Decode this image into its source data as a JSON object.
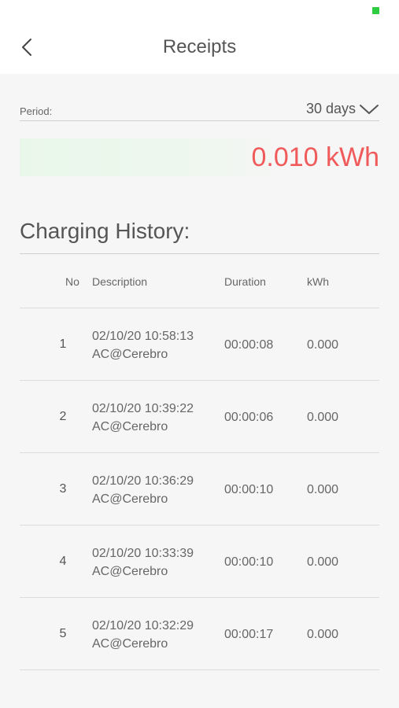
{
  "header": {
    "title": "Receipts"
  },
  "filter": {
    "period_label": "Period:",
    "period_value": "30 days"
  },
  "summary": {
    "total_kwh": "0.010 kWh"
  },
  "history": {
    "title": "Charging History:",
    "columns": {
      "no": "No",
      "description": "Description",
      "duration": "Duration",
      "kwh": "kWh"
    },
    "rows": [
      {
        "no": "1",
        "datetime": "02/10/20 10:58:13",
        "station": "AC@Cerebro",
        "duration": "00:00:08",
        "kwh": "0.000"
      },
      {
        "no": "2",
        "datetime": "02/10/20 10:39:22",
        "station": "AC@Cerebro",
        "duration": "00:00:06",
        "kwh": "0.000"
      },
      {
        "no": "3",
        "datetime": "02/10/20 10:36:29",
        "station": "AC@Cerebro",
        "duration": "00:00:10",
        "kwh": "0.000"
      },
      {
        "no": "4",
        "datetime": "02/10/20 10:33:39",
        "station": "AC@Cerebro",
        "duration": "00:00:10",
        "kwh": "0.000"
      },
      {
        "no": "5",
        "datetime": "02/10/20 10:32:29",
        "station": "AC@Cerebro",
        "duration": "00:00:17",
        "kwh": "0.000"
      }
    ]
  },
  "colors": {
    "accent_red": "#f05a5a",
    "battery_green": "#2ecc40"
  }
}
